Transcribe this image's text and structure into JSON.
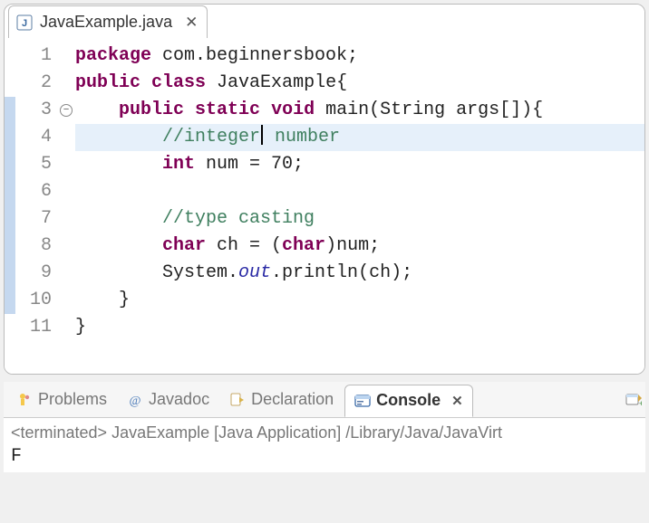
{
  "editor": {
    "tab": {
      "filename": "JavaExample.java"
    },
    "current_line": 4,
    "marked_lines": [
      3,
      4,
      5,
      6,
      7,
      8,
      9,
      10
    ],
    "fold_line": 3,
    "lines": [
      {
        "n": 1,
        "tokens": [
          [
            "kw",
            "package"
          ],
          [
            "txt",
            " com.beginnersbook;"
          ]
        ]
      },
      {
        "n": 2,
        "tokens": [
          [
            "kw",
            "public"
          ],
          [
            "txt",
            " "
          ],
          [
            "kw",
            "class"
          ],
          [
            "txt",
            " JavaExample{"
          ]
        ]
      },
      {
        "n": 3,
        "tokens": [
          [
            "txt",
            "    "
          ],
          [
            "kw",
            "public"
          ],
          [
            "txt",
            " "
          ],
          [
            "kw",
            "static"
          ],
          [
            "txt",
            " "
          ],
          [
            "kw",
            "void"
          ],
          [
            "txt",
            " main(String args[]){"
          ]
        ]
      },
      {
        "n": 4,
        "tokens": [
          [
            "txt",
            "        "
          ],
          [
            "cm",
            "//integer"
          ],
          [
            "caret",
            ""
          ],
          [
            "cm",
            " number"
          ]
        ]
      },
      {
        "n": 5,
        "tokens": [
          [
            "txt",
            "        "
          ],
          [
            "kw",
            "int"
          ],
          [
            "txt",
            " num = 70;"
          ]
        ]
      },
      {
        "n": 6,
        "tokens": []
      },
      {
        "n": 7,
        "tokens": [
          [
            "txt",
            "        "
          ],
          [
            "cm",
            "//type casting"
          ]
        ]
      },
      {
        "n": 8,
        "tokens": [
          [
            "txt",
            "        "
          ],
          [
            "kw",
            "char"
          ],
          [
            "txt",
            " ch = ("
          ],
          [
            "kw",
            "char"
          ],
          [
            "txt",
            ")num;"
          ]
        ]
      },
      {
        "n": 9,
        "tokens": [
          [
            "txt",
            "        System."
          ],
          [
            "st",
            "out"
          ],
          [
            "txt",
            ".println(ch);"
          ]
        ]
      },
      {
        "n": 10,
        "tokens": [
          [
            "txt",
            "    }"
          ]
        ]
      },
      {
        "n": 11,
        "tokens": [
          [
            "txt",
            "}"
          ]
        ]
      }
    ]
  },
  "views": {
    "tabs": [
      {
        "id": "problems",
        "label": "Problems",
        "active": false
      },
      {
        "id": "javadoc",
        "label": "Javadoc",
        "active": false
      },
      {
        "id": "declaration",
        "label": "Declaration",
        "active": false
      },
      {
        "id": "console",
        "label": "Console",
        "active": true
      }
    ]
  },
  "console": {
    "status": "<terminated> JavaExample [Java Application] /Library/Java/JavaVirt",
    "output": "F"
  }
}
